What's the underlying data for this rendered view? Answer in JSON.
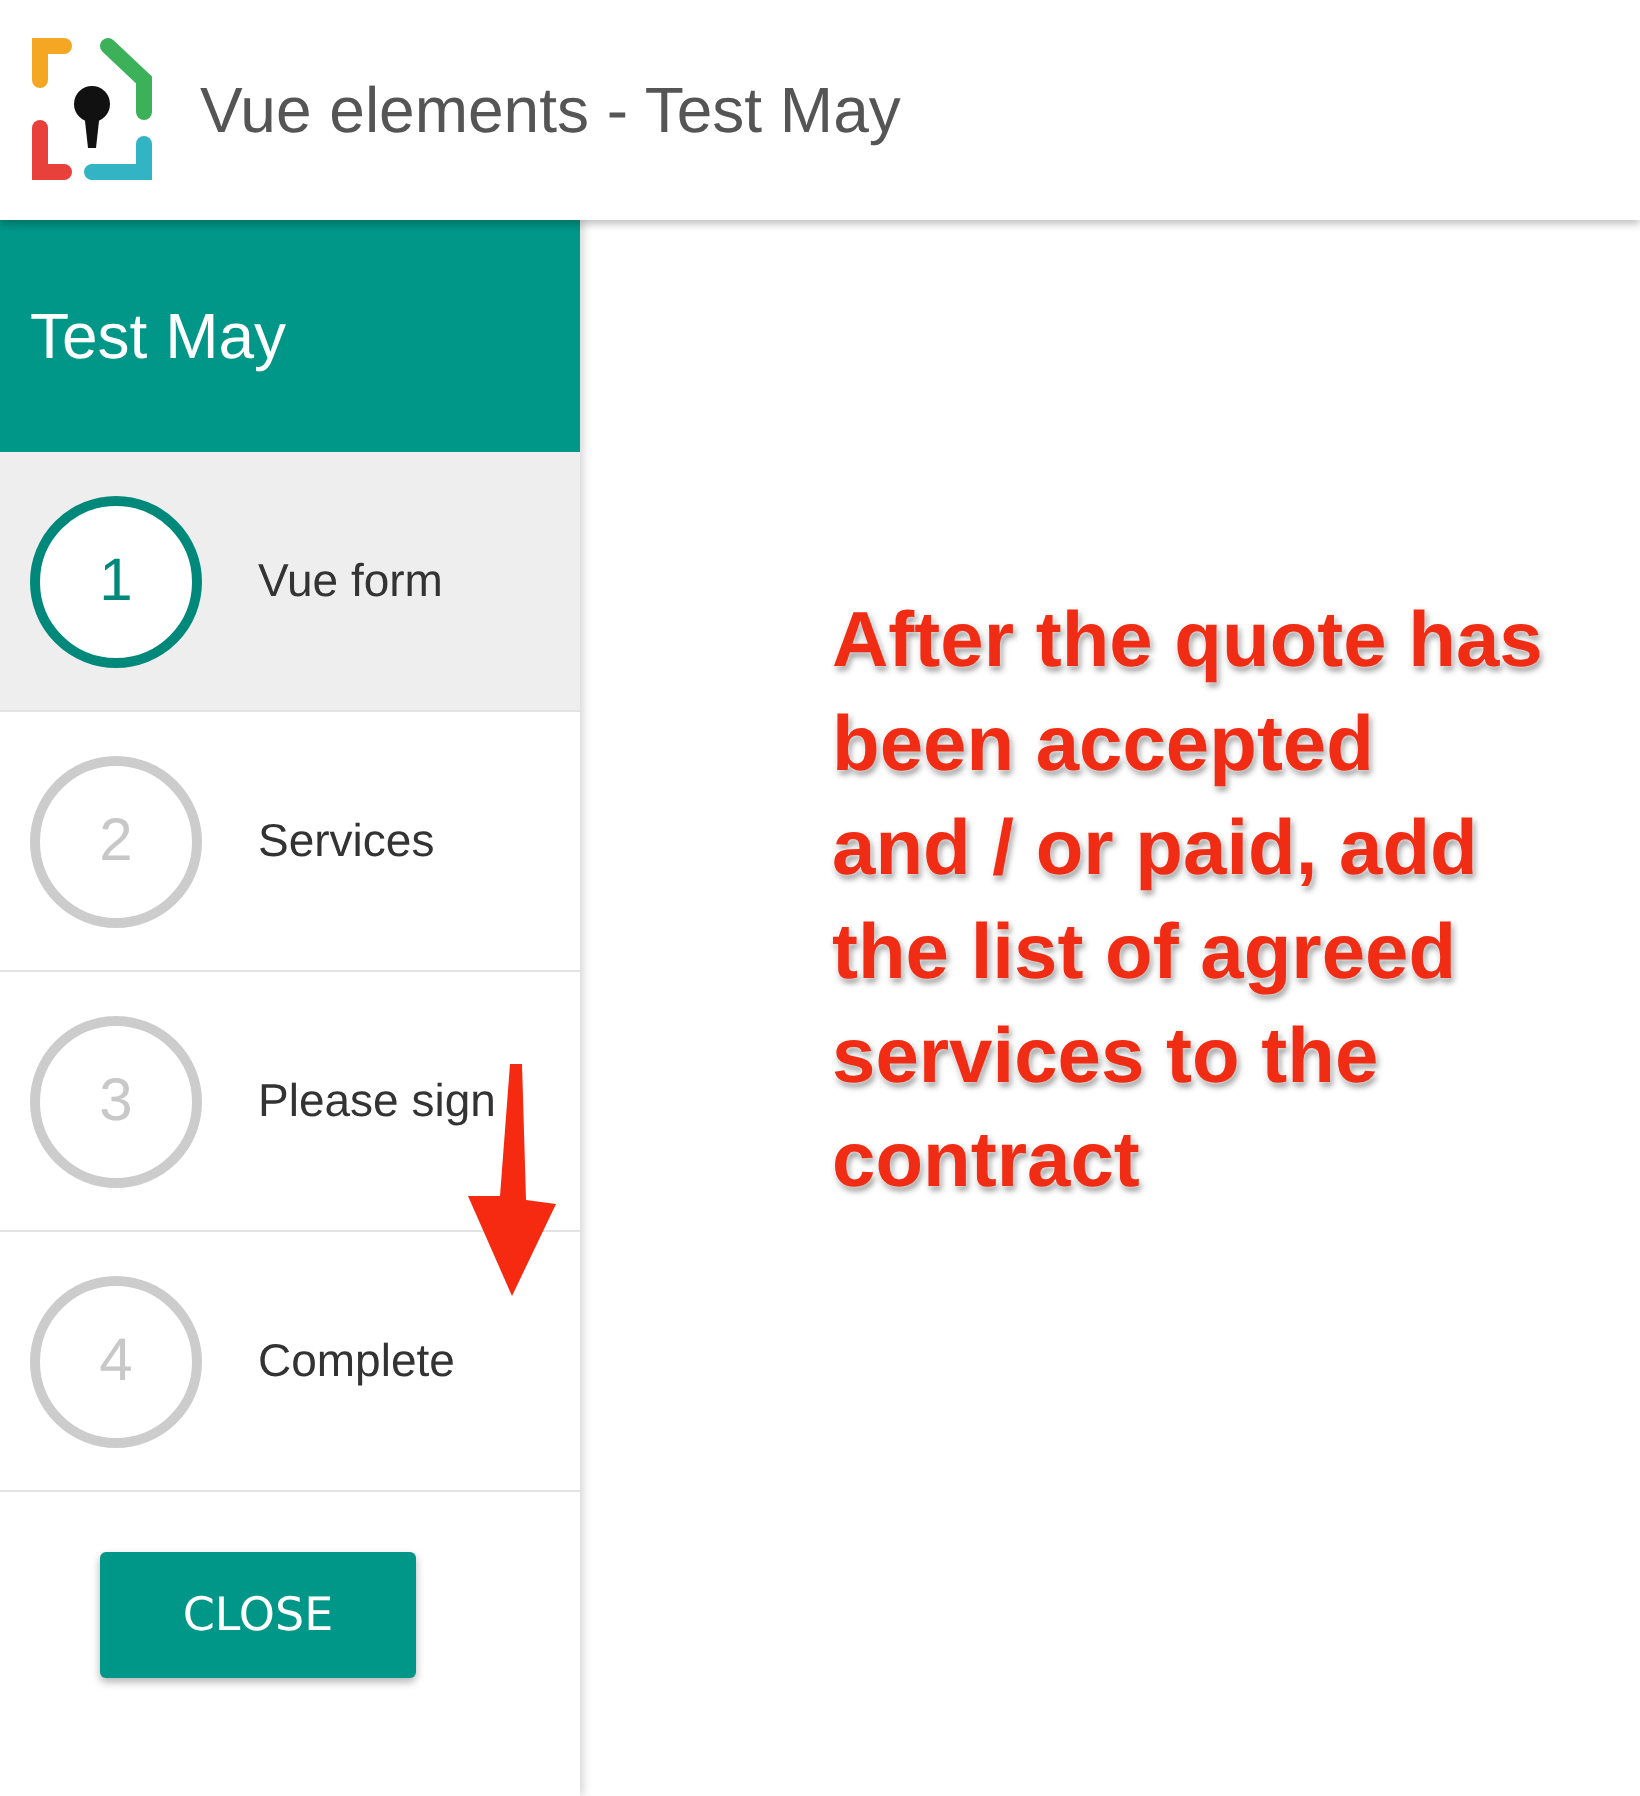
{
  "header": {
    "title": "Vue elements - Test May"
  },
  "sidebar": {
    "title": "Test May",
    "steps": [
      {
        "number": "1",
        "label": "Vue form",
        "selected": true
      },
      {
        "number": "2",
        "label": "Services",
        "selected": false
      },
      {
        "number": "3",
        "label": "Please sign",
        "selected": false
      },
      {
        "number": "4",
        "label": "Complete",
        "selected": false
      }
    ],
    "close_button": "CLOSE"
  },
  "annotation": {
    "text": "After the quote has\nbeen accepted\nand / or paid, add\nthe list of agreed\nservices to the\ncontract"
  }
}
